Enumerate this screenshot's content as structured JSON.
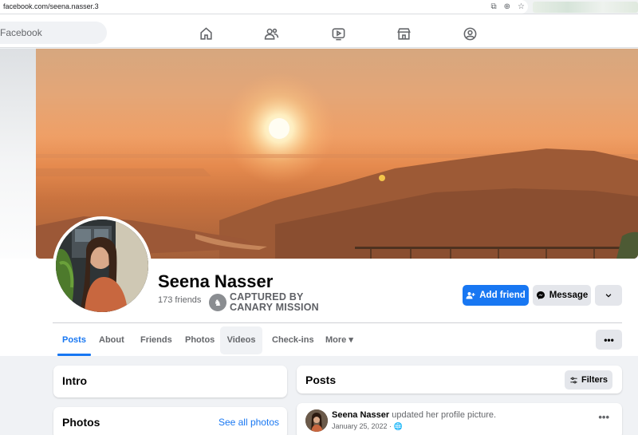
{
  "browser": {
    "url": "facebook.com/seena.nasser.3",
    "icons": [
      "install-icon",
      "zoom-icon",
      "star-icon"
    ]
  },
  "nav": {
    "search_placeholder": "Facebook",
    "icons": [
      "home-icon",
      "friends-icon",
      "watch-icon",
      "marketplace-icon",
      "groups-icon"
    ]
  },
  "profile": {
    "name": "Seena Nasser",
    "friends_count": "173 friends",
    "stamp_line1": "CAPTURED BY",
    "stamp_line2": "CANARY MISSION"
  },
  "actions": {
    "add_friend": "Add friend",
    "message": "Message",
    "more": "⌄"
  },
  "tabs": [
    {
      "label": "Posts",
      "active": true
    },
    {
      "label": "About"
    },
    {
      "label": "Friends"
    },
    {
      "label": "Photos"
    },
    {
      "label": "Videos"
    },
    {
      "label": "Check-ins"
    },
    {
      "label": "More ▾"
    }
  ],
  "tab_menu": "•••",
  "intro": {
    "title": "Intro"
  },
  "photos": {
    "title": "Photos",
    "see_all": "See all photos"
  },
  "posts": {
    "title": "Posts",
    "filters": "Filters"
  },
  "post": {
    "author": "Seena Nasser",
    "action": "updated her profile picture.",
    "date": "January 25, 2022 · ",
    "menu": "•••"
  },
  "colors": {
    "primary": "#1877f2",
    "button_grey": "#e4e6eb",
    "secondary_text": "#65676b"
  }
}
